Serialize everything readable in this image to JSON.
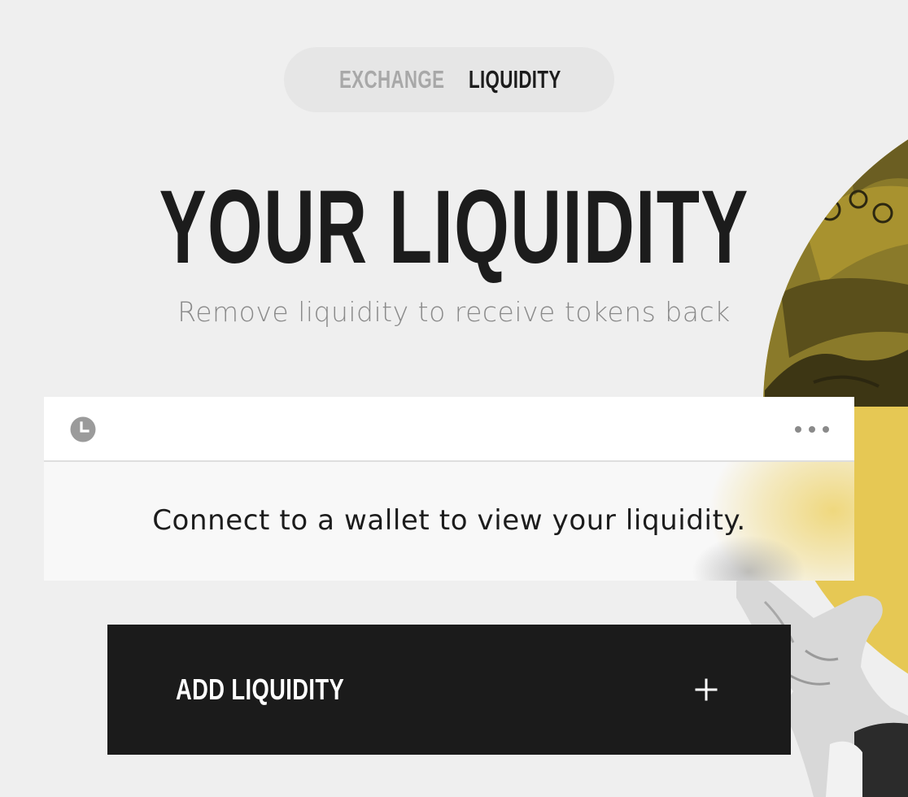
{
  "nav": {
    "tabs": [
      {
        "label": "EXCHANGE",
        "active": false
      },
      {
        "label": "LIQUIDITY",
        "active": true
      }
    ]
  },
  "header": {
    "title": "YOUR LIQUIDITY",
    "subtitle": "Remove liquidity to receive tokens back"
  },
  "panel": {
    "history_icon": "clock-icon",
    "menu_icon": "more-horizontal-icon",
    "message": "Connect to a wallet to view your liquidity."
  },
  "actions": {
    "add_liquidity_label": "ADD LIQUIDITY",
    "add_icon": "plus-icon"
  },
  "colors": {
    "background": "#efefef",
    "text": "#1c1c1c",
    "muted": "#a8a8a8",
    "button": "#1b1b1b",
    "accent": "#e6c854"
  }
}
